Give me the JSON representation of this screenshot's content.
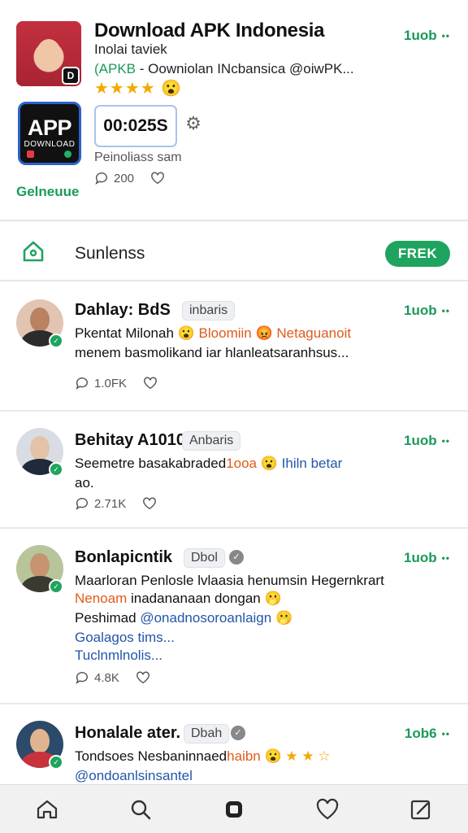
{
  "header": {
    "title": "Download APK Indonesia",
    "subtitle": "Inolai taviek",
    "desc_tag": "(APKB",
    "desc_rest": " - Oowniolan INcbansica @oiwPK...",
    "stars": "★★★★",
    "avatar_badge": "D",
    "app_icon_text": "APP",
    "app_icon_sub": "DOWNLOAD",
    "timer": "00:025S",
    "followers": "Peinoliass sam",
    "likes": "200",
    "online": "Gelneuue",
    "time": "1uob",
    "more": "••"
  },
  "section": {
    "label": "Sunlenss",
    "pill": "FREK"
  },
  "posts": [
    {
      "name": "Dahlay: BdS",
      "chip": "inbaris",
      "time": "1uob",
      "line1_a": "Pkentat Milonah ",
      "line1_b": "Bloomiin",
      "line1_c": "Netaguanoit",
      "line2": "menem basmolikand iar hlanleatsaranhsus...",
      "count": "1.0FK"
    },
    {
      "name": "Behitay A1010",
      "chip": "Anbaris",
      "time": "1uob",
      "line1_a": "Seemetre basakabraded",
      "line1_b": "1ooa",
      "line1_c": "Ihiln betar",
      "line2": "ao.",
      "count": "2.71K"
    },
    {
      "name": "Bonlapicntik",
      "chip": "Dbol",
      "time": "1uob",
      "line1": "Maarloran Penlosle lvlaasia henumsin Hegernkrart",
      "line2_a": "Nenoam",
      "line2_b": " inadananaan dongan",
      "line3_a": "Peshimad ",
      "line3_b": "@onadnosoroanlaign",
      "line4": "Goalagos tims...",
      "line5": "Tuclnmlnolis...",
      "count": "4.8K"
    },
    {
      "name": "Honalale ater.",
      "chip": "Dbah",
      "time": "1ob6",
      "line1_a": "Tondsoes Nesbaninnaed",
      "line1_b": "haibn",
      "line2": "@ondoanlsinsantel"
    }
  ],
  "colors": {
    "accent_green": "#1fa45f",
    "link_blue": "#2256a8",
    "highlight_orange": "#e05a1c",
    "star_gold": "#f2a900"
  }
}
